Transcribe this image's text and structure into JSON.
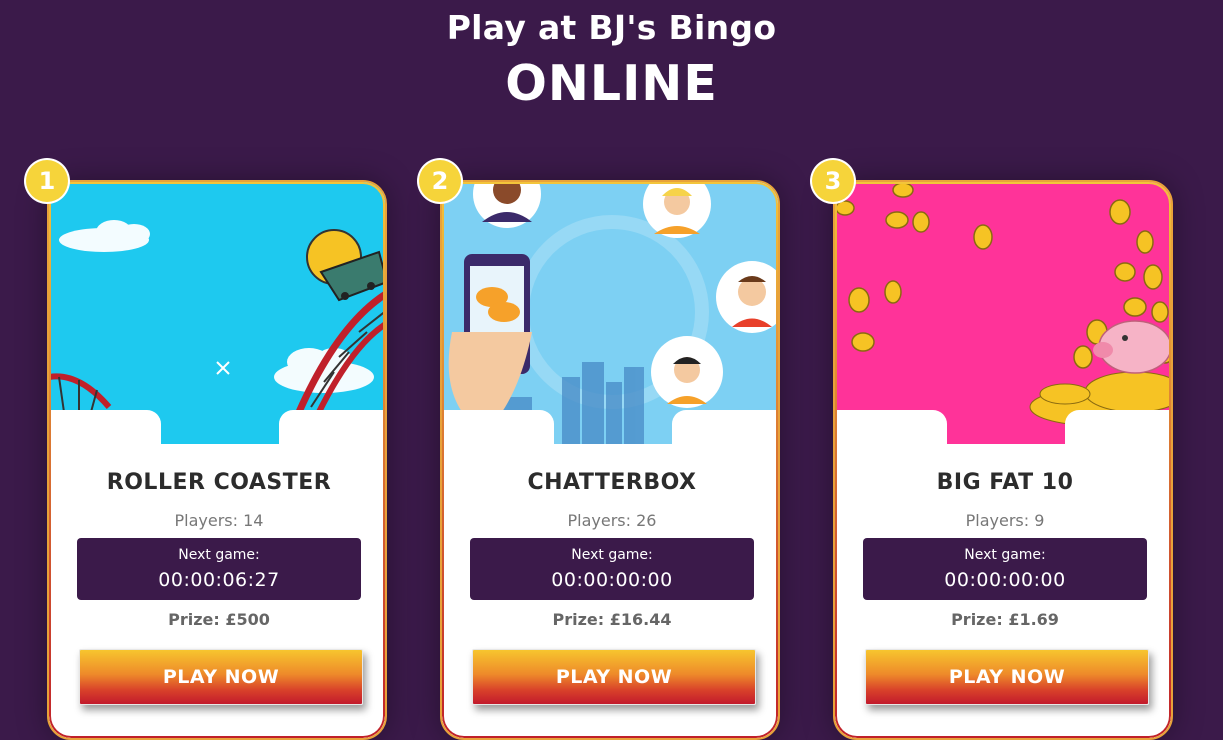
{
  "header": {
    "line1": "Play at BJ's Bingo",
    "line2": "ONLINE"
  },
  "games": [
    {
      "rank": "1",
      "name": "ROLLER COASTER",
      "players": "Players: 14",
      "next_game_label": "Next game:",
      "next_game_time": "00:00:06:27",
      "prize": "Prize: £500",
      "button_label": "PLAY NOW",
      "image_bg": "#1ec9ef"
    },
    {
      "rank": "2",
      "name": "CHATTERBOX",
      "players": "Players: 26",
      "next_game_label": "Next game:",
      "next_game_time": "00:00:00:00",
      "prize": "Prize: £16.44",
      "button_label": "PLAY NOW",
      "image_bg": "#7dd0f3"
    },
    {
      "rank": "3",
      "name": "BIG FAT 10",
      "players": "Players: 9",
      "next_game_label": "Next game:",
      "next_game_time": "00:00:00:00",
      "prize": "Prize: £1.69",
      "button_label": "PLAY NOW",
      "image_bg": "#ff3399"
    }
  ],
  "colors": {
    "background": "#3b1a4a",
    "badge": "#f6d43a",
    "timer_bg": "#3b1a4a"
  }
}
